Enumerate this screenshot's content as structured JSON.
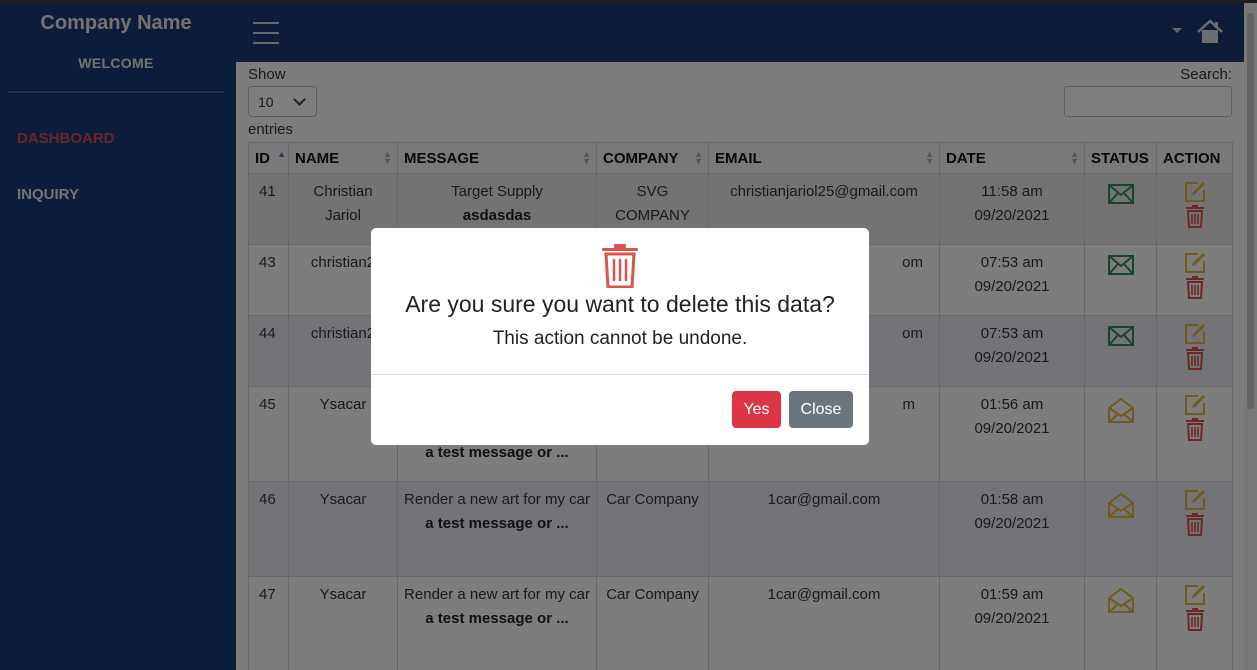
{
  "sidebar": {
    "brand": "Company Name",
    "welcome": "WELCOME",
    "items": [
      {
        "label": "DASHBOARD"
      },
      {
        "label": "INQUIRY"
      }
    ]
  },
  "controls": {
    "show_label": "Show",
    "page_size": "10",
    "entries_label": "entries",
    "search_label": "Search:",
    "search_value": ""
  },
  "table": {
    "columns": [
      "ID",
      "NAME",
      "MESSAGE",
      "COMPANY",
      "EMAIL",
      "DATE",
      "STATUS",
      "ACTION"
    ],
    "rows": [
      {
        "id": "41",
        "name": "Christian Jariol",
        "message": "Target Supply",
        "message_bold": "asdasdas",
        "company": "SVG COMPANY",
        "email": "christianjariol25@gmail.com",
        "time": "11:58 am",
        "date": "09/20/2021",
        "status": "unread"
      },
      {
        "id": "43",
        "name": "christian2",
        "message": "",
        "message_bold": "",
        "company": "",
        "email": "om",
        "time": "07:53 am",
        "date": "09/20/2021",
        "status": "unread"
      },
      {
        "id": "44",
        "name": "christian2",
        "message": "",
        "message_bold": "",
        "company": "",
        "email": "om",
        "time": "07:53 am",
        "date": "09/20/2021",
        "status": "unread"
      },
      {
        "id": "45",
        "name": "Ysacar",
        "message": "",
        "message_bold": "a test message or ...",
        "company": "",
        "email": "m",
        "time": "01:56 am",
        "date": "09/20/2021",
        "status": "read"
      },
      {
        "id": "46",
        "name": "Ysacar",
        "message": "Render a new art for my car",
        "message_bold": "a test message or ...",
        "company": "Car Company",
        "email": "1car@gmail.com",
        "time": "01:58 am",
        "date": "09/20/2021",
        "status": "read"
      },
      {
        "id": "47",
        "name": "Ysacar",
        "message": "Render a new art for my car",
        "message_bold": "a test message or ...",
        "company": "Car Company",
        "email": "1car@gmail.com",
        "time": "01:59 am",
        "date": "09/20/2021",
        "status": "read"
      }
    ]
  },
  "modal": {
    "title": "Are you sure you want to delete this data?",
    "subtitle": "This action cannot be undone.",
    "yes_label": "Yes",
    "close_label": "Close"
  },
  "colors": {
    "sidebar": "#183a78",
    "header": "#1b3a73",
    "danger": "#dc3545",
    "secondary": "#6c757d",
    "status_unread": "#2e8b57",
    "status_read": "#e0b43a",
    "edit": "#e0b43a",
    "delete": "#d9534f"
  },
  "icons": {
    "menu": "hamburger-icon",
    "home": "home-icon",
    "unread": "envelope-closed-icon",
    "read": "envelope-open-icon",
    "edit": "edit-icon",
    "delete": "trash-icon"
  }
}
